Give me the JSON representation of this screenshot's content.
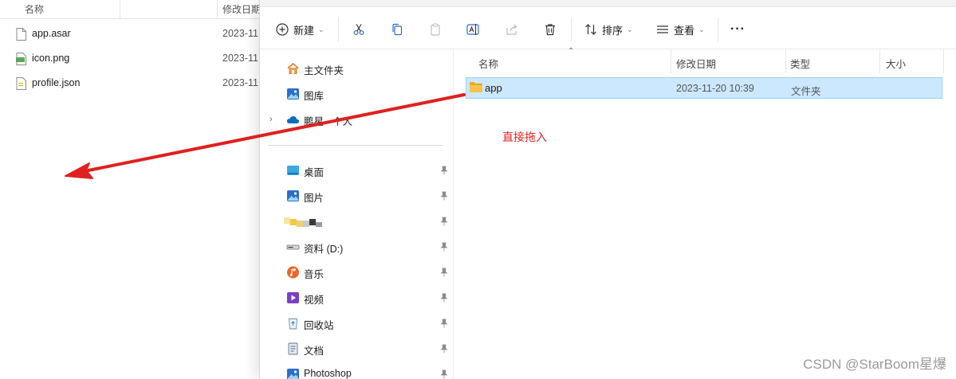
{
  "background_window": {
    "column_name": "名称",
    "column_modified": "修改日期",
    "files": [
      {
        "name": "app.asar",
        "date": "2023-11",
        "icon": "file-icon"
      },
      {
        "name": "icon.png",
        "date": "2023-11",
        "icon": "png-icon"
      },
      {
        "name": "profile.json",
        "date": "2023-11",
        "icon": "json-file-icon"
      }
    ]
  },
  "toolbar": {
    "new_label": "新建",
    "sort_label": "排序",
    "view_label": "查看",
    "more_label": "···"
  },
  "nav": {
    "home": "主文件夹",
    "gallery": "图库",
    "onedrive": "鹏星 - 个人",
    "desktop": "桌面",
    "pictures": "图片",
    "drive_d": "资料 (D:)",
    "music": "音乐",
    "videos": "视频",
    "recycle_bin": "回收站",
    "documents": "文档",
    "photoshop": "Photoshop"
  },
  "content": {
    "col_name": "名称",
    "col_modified": "修改日期",
    "col_type": "类型",
    "col_size": "大小",
    "rows": [
      {
        "name": "app",
        "modified": "2023-11-20 10:39",
        "type": "文件夹"
      }
    ]
  },
  "annotation": "直接拖入",
  "watermark": "CSDN @StarBoom星爆",
  "colors": {
    "selection_bg": "#cce8ff",
    "selection_border": "#99d1ff",
    "annotation_red": "#e02020",
    "folder_yellow": "#f8c34a"
  }
}
